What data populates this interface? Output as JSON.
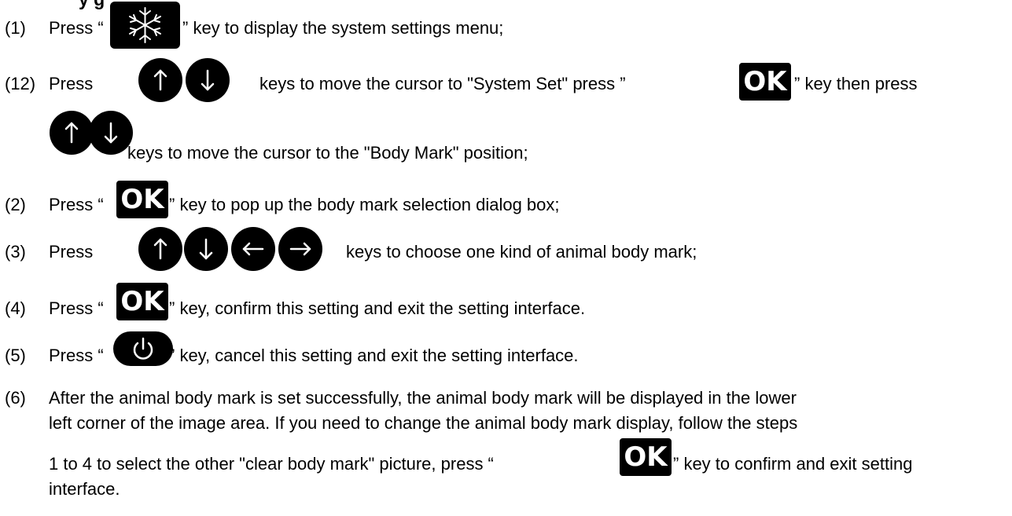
{
  "heading": "y    g",
  "steps": [
    {
      "num": "(1)",
      "pre": "Press “",
      "post": "” key to display the system settings menu;"
    },
    {
      "num": "(12)",
      "pre": "Press",
      "mid": "keys to move the cursor to \"System Set\" press ”",
      "mid2": "” key then press",
      "cont": "keys to move the cursor to the \"Body Mark\" position;"
    },
    {
      "num": "(2)",
      "pre": "Press “",
      "post": "” key to pop up the body mark selection dialog box;"
    },
    {
      "num": "(3)",
      "pre": "Press",
      "post": "keys to choose one kind of animal body mark;"
    },
    {
      "num": "(4)",
      "pre": "Press “",
      "post": "” key, confirm this setting and exit the setting interface."
    },
    {
      "num": "(5)",
      "pre": "Press “",
      "post": "” key, cancel this setting and exit the setting interface."
    },
    {
      "num": "(6)",
      "line1": "After the animal body mark is set successfully, the animal body mark will be displayed in the lower",
      "line2": "left corner of the image area. If you need to change the animal body mark display, follow the steps",
      "line3a": "1 to 4 to select the other \"clear body mark\" picture, press “",
      "line3b": "” key to confirm and exit setting",
      "line4": "interface."
    }
  ],
  "keys": {
    "ok": "OK",
    "freeze": "freeze-icon",
    "up": "up-arrow-icon",
    "down": "down-arrow-icon",
    "left": "left-arrow-icon",
    "right": "right-arrow-icon",
    "power": "power-icon"
  }
}
